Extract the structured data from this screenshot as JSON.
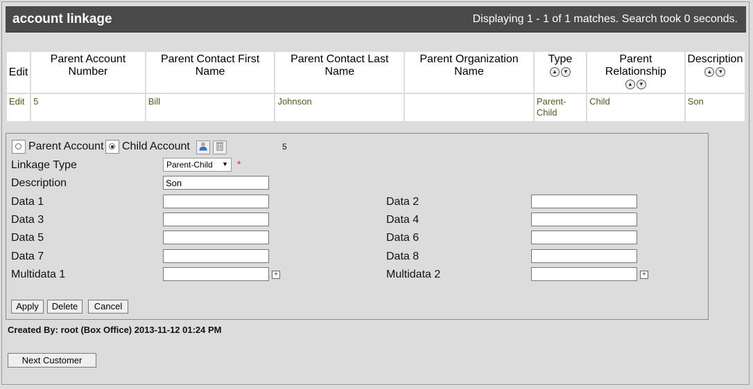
{
  "header": {
    "title": "account linkage",
    "status": "Displaying 1 - 1 of 1 matches. Search took 0 seconds."
  },
  "table": {
    "columns": [
      "Edit",
      "Parent Account Number",
      "Parent Contact First Name",
      "Parent Contact Last Name",
      "Parent Organization Name",
      "Type",
      "Parent Relationship",
      "Description"
    ],
    "rows": [
      [
        "Edit",
        "5",
        "Bill",
        "Johnson",
        "",
        "Parent-Child",
        "Child",
        "Son"
      ]
    ]
  },
  "form": {
    "parent_account_label": "Parent Account",
    "child_account_label": "Child Account",
    "account_number": "5",
    "linkage_type_label": "Linkage Type",
    "linkage_type_value": "Parent-Child",
    "required_mark": "*",
    "description_label": "Description",
    "description_value": "Son",
    "data1_label": "Data 1",
    "data2_label": "Data 2",
    "data3_label": "Data 3",
    "data4_label": "Data 4",
    "data5_label": "Data 5",
    "data6_label": "Data 6",
    "data7_label": "Data 7",
    "data8_label": "Data 8",
    "multidata1_label": "Multidata 1",
    "multidata2_label": "Multidata 2",
    "apply_label": "Apply",
    "delete_label": "Delete",
    "cancel_label": "Cancel",
    "selected_radio": "child"
  },
  "footer": {
    "created_by": "Created By: root (Box Office) 2013-11-12 01:24 PM",
    "next_customer_label": "Next Customer"
  },
  "icons": {
    "sort": "sort-up-down-icon",
    "person": "person-icon",
    "trash": "trash-icon",
    "expand": "plus-box-icon"
  },
  "colors": {
    "titlebar": "#4a4a4a",
    "link": "#4b5e12",
    "required": "#dd2222"
  }
}
